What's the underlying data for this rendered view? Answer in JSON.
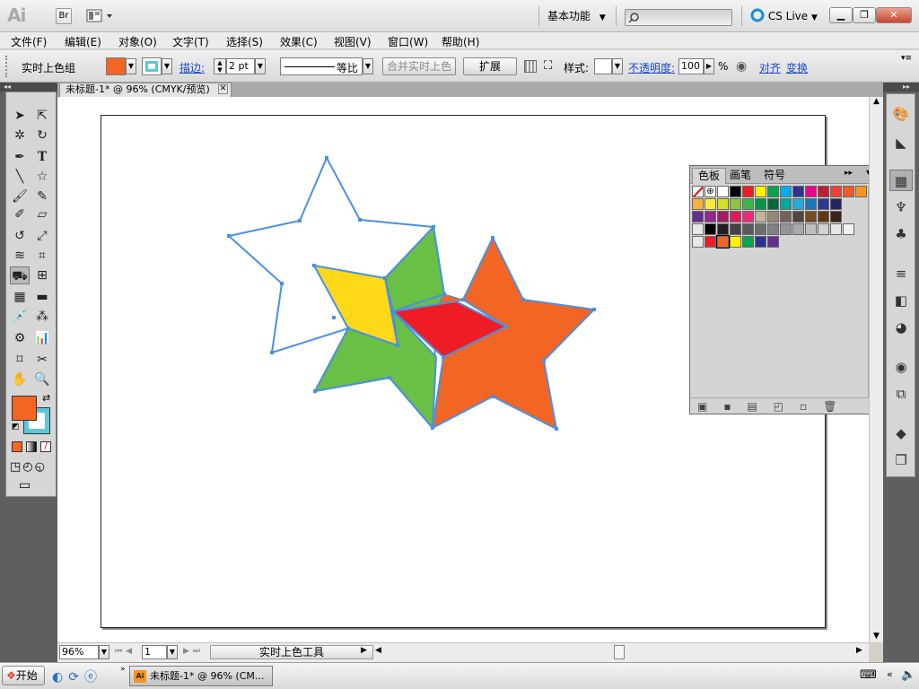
{
  "app": {
    "logo": "Ai",
    "bridge_label": "Br",
    "workspace": "基本功能",
    "cs_live": "CS Live",
    "search_placeholder": ""
  },
  "menu": [
    "文件(F)",
    "编辑(E)",
    "对象(O)",
    "文字(T)",
    "选择(S)",
    "效果(C)",
    "视图(V)",
    "窗口(W)",
    "帮助(H)"
  ],
  "control": {
    "selection_label": "实时上色组",
    "fill_color": "#f26522",
    "stroke_color": "#5bc8d8",
    "stroke_label": "描边:",
    "stroke_weight": "2 pt",
    "stroke_profile": "等比",
    "merge_live_paint": "合并实时上色",
    "expand": "扩展",
    "style_label": "样式:",
    "opacity_label": "不透明度:",
    "opacity_value": "100",
    "percent": "%",
    "align_link": "对齐",
    "transform_link": "变换"
  },
  "document": {
    "tab_title": "未标题-1* @ 96% (CMYK/预览)",
    "zoom": "96%",
    "artboard_number": "1",
    "status_tool": "实时上色工具"
  },
  "colors": {
    "star_stroke": "#4a90e2",
    "green": "#6abf45",
    "yellow": "#ffd817",
    "red": "#ee1c25",
    "orange": "#f26522"
  },
  "swatch_panel": {
    "tabs": [
      "色板",
      "画笔",
      "符号"
    ],
    "rows": [
      [
        "#ffffff",
        "#000000",
        "#ed1c24",
        "#fff200",
        "#00a651",
        "#00aeef",
        "#2e3192",
        "#ec008c",
        "#be1e2d",
        "#ef4136",
        "#f15a29",
        "#f7941d"
      ],
      [
        "#fbb040",
        "#f9ed32",
        "#d7df23",
        "#8dc63f",
        "#39b54a",
        "#009444",
        "#006838",
        "#00a79d",
        "#27aae1",
        "#1c75bc",
        "#2b3990",
        "#262262"
      ],
      [
        "#662d91",
        "#92278f",
        "#9e1f63",
        "#da1c5c",
        "#ee2a7b",
        "#c2b59b",
        "#998675",
        "#736357",
        "#534741",
        "#c69c6d",
        "#a67c52",
        "#8c6239"
      ],
      [
        "#754c24",
        "#603913",
        "#3c2415"
      ],
      [
        "#000000",
        "#231f20",
        "#414042",
        "#58595b",
        "#6d6e71",
        "#808285",
        "#939598",
        "#a7a9ac",
        "#bcbec0",
        "#d1d3d4",
        "#e6e7e8",
        "#f1f2f2"
      ],
      [
        "#ed1c24",
        "#f26522",
        "#fff200",
        "#00a651",
        "#2e3192",
        "#662d91"
      ]
    ]
  },
  "taskbar": {
    "start": "开始",
    "task_title": "未标题-1* @ 96% (CM..."
  }
}
